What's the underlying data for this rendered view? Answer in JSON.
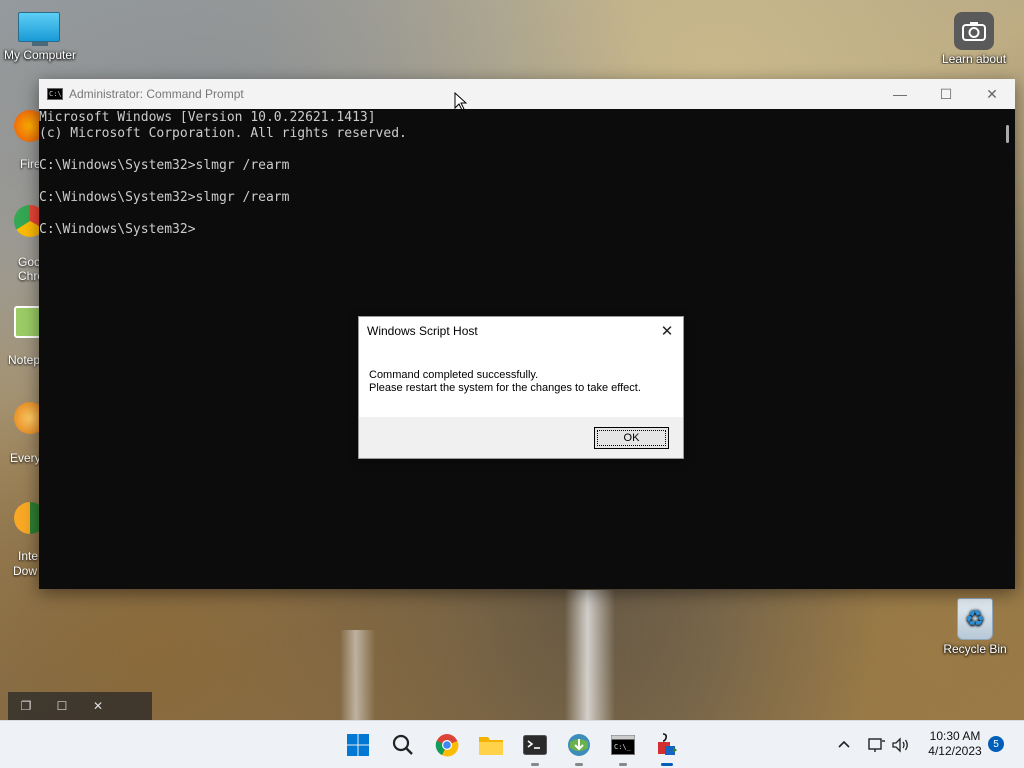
{
  "desktop": {
    "icons": {
      "my_computer": "My Computer",
      "learn_about": "Learn about",
      "recycle_bin": "Recycle Bin"
    },
    "partial_labels": [
      "Fire",
      "Goo",
      "Chro",
      "Notep",
      "Every",
      "Inte",
      "Dow"
    ]
  },
  "cmd_window": {
    "title": "Administrator: Command Prompt",
    "icon_text": "C:\\",
    "controls": {
      "minimize": "—",
      "maximize": "☐",
      "close": "✕"
    },
    "lines": [
      "Microsoft Windows [Version 10.0.22621.1413]",
      "(c) Microsoft Corporation. All rights reserved.",
      "",
      "C:\\Windows\\System32>slmgr /rearm",
      "",
      "C:\\Windows\\System32>slmgr /rearm",
      "",
      "C:\\Windows\\System32>"
    ]
  },
  "dialog": {
    "title": "Windows Script Host",
    "close": "✕",
    "message_line1": "Command completed successfully.",
    "message_line2": "Please restart the system for the changes to take effect.",
    "ok_label": "OK"
  },
  "minimized_strip": {
    "restore": "❐",
    "maximize": "☐",
    "close": "✕"
  },
  "taskbar": {
    "apps": [
      "start-icon",
      "search-icon",
      "chrome-icon",
      "file-explorer-icon",
      "terminal-icon",
      "internet-download-manager-icon",
      "command-prompt-icon",
      "script-host-icon"
    ],
    "tray": {
      "chevron": "^",
      "clock_time": "10:30 AM",
      "clock_date": "4/12/2023",
      "notifications": "5"
    }
  },
  "colors": {
    "console_bg": "#0c0c0c",
    "console_text": "#cccccc",
    "accent": "#005fb8"
  }
}
